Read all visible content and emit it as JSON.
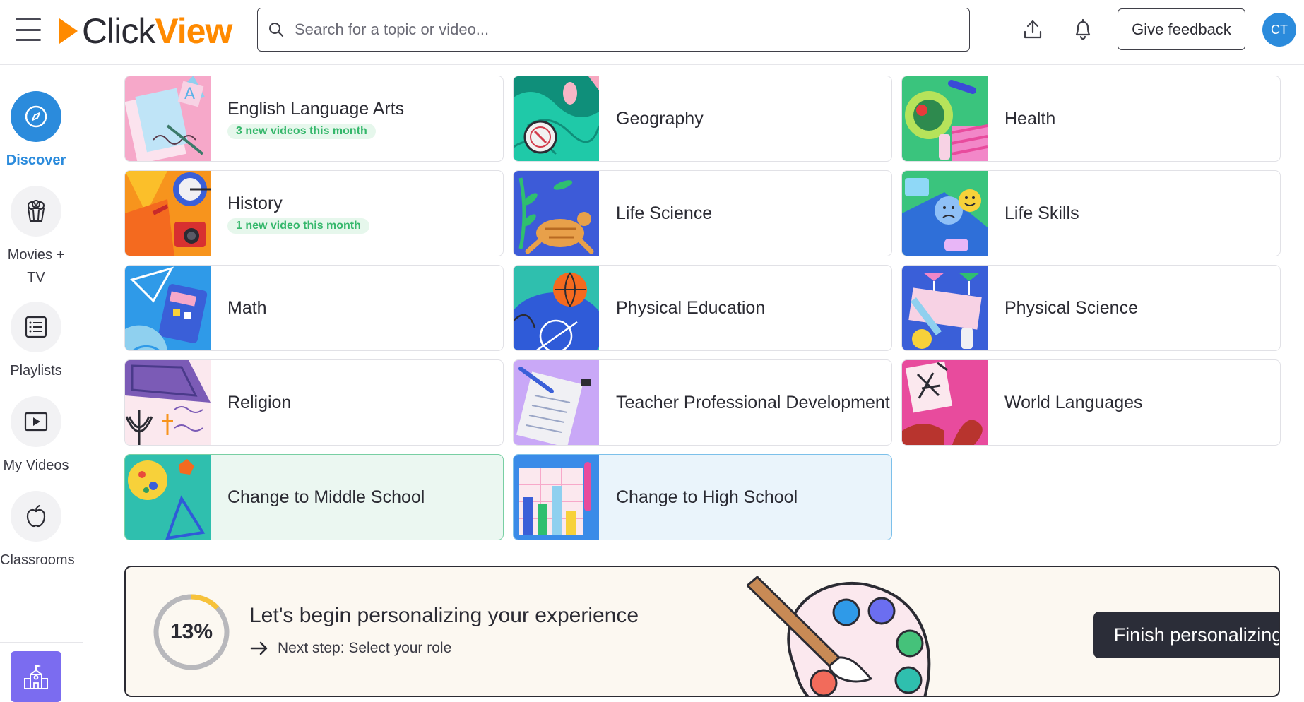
{
  "header": {
    "logo_part1": "Click",
    "logo_part2": "View",
    "search_placeholder": "Search for a topic or video...",
    "upload_icon": "upload-icon",
    "bell_icon": "bell-icon",
    "feedback_label": "Give feedback",
    "avatar_initials": "CT"
  },
  "sidebar": {
    "items": [
      {
        "label": "Discover",
        "icon": "compass-icon",
        "active": true
      },
      {
        "label": "Movies + TV",
        "icon": "popcorn-icon",
        "active": false
      },
      {
        "label": "Playlists",
        "icon": "list-icon",
        "active": false
      },
      {
        "label": "My Videos",
        "icon": "play-icon",
        "active": false
      },
      {
        "label": "Classrooms",
        "icon": "apple-icon",
        "active": false
      }
    ],
    "school_icon": "school-icon"
  },
  "subjects": [
    {
      "title": "English Language Arts",
      "badge": "3 new videos this month"
    },
    {
      "title": "Geography",
      "badge": ""
    },
    {
      "title": "Health",
      "badge": ""
    },
    {
      "title": "History",
      "badge": "1 new video this month"
    },
    {
      "title": "Life Science",
      "badge": ""
    },
    {
      "title": "Life Skills",
      "badge": ""
    },
    {
      "title": "Math",
      "badge": ""
    },
    {
      "title": "Physical Education",
      "badge": ""
    },
    {
      "title": "Physical Science",
      "badge": ""
    },
    {
      "title": "Religion",
      "badge": ""
    },
    {
      "title": "Teacher Professional Development",
      "badge": ""
    },
    {
      "title": "World Languages",
      "badge": ""
    }
  ],
  "change_cards": [
    {
      "title": "Change to Middle School"
    },
    {
      "title": "Change to High School"
    }
  ],
  "personalize": {
    "progress": 0.13,
    "progress_label": "13%",
    "title": "Let's begin personalizing your experience",
    "next_step": "Next step: Select your role",
    "button_label": "Finish personalizing"
  },
  "colors": {
    "brand_orange": "#ff8a00",
    "accent_blue": "#2b8bdc",
    "badge_green": "#35b76b",
    "dark_button": "#2b2d38"
  }
}
